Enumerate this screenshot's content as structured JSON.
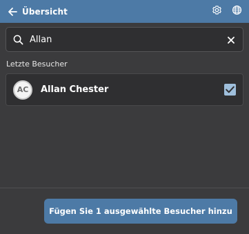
{
  "header": {
    "back_label": "Übersicht",
    "back_icon": "arrow-left-icon",
    "settings_icon": "gear-icon",
    "language_icon": "globe-icon",
    "background_color": "#4d7aa6"
  },
  "search": {
    "value": "Allan",
    "icon": "search-icon",
    "clear_icon": "close-icon"
  },
  "recent_visitors": {
    "label": "Letzte Besucher",
    "items": [
      {
        "avatar_initials": "AC",
        "name": "Allan Chester",
        "selected": true
      }
    ]
  },
  "footer": {
    "action_label": "Fügen Sie 1 ausgewählte Besucher hinzu",
    "accent_color": "#4d7aa6"
  }
}
